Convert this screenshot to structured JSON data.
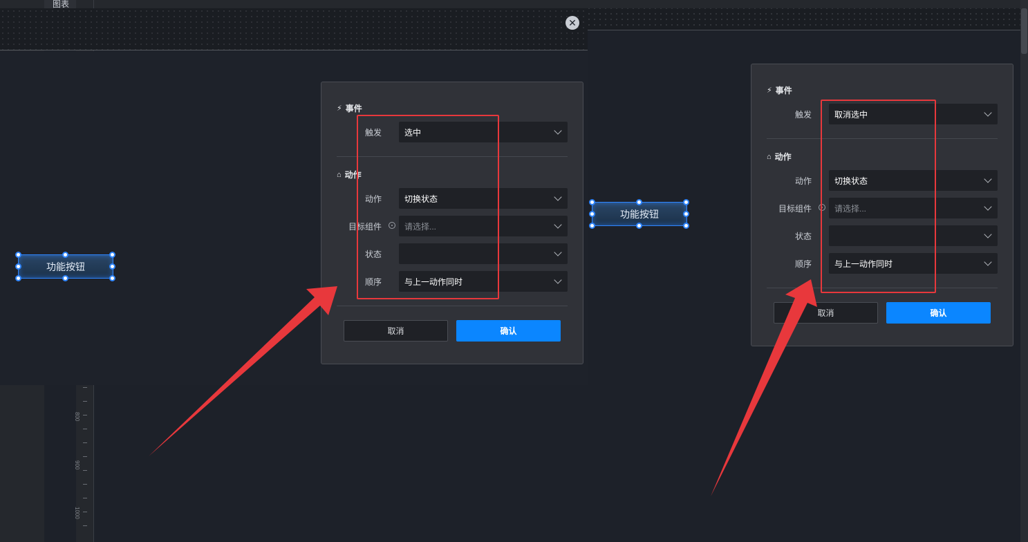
{
  "editor": {
    "tab_label": "图表",
    "ruler_numbers": [
      "800",
      "900",
      "1000"
    ]
  },
  "left_dialog": {
    "close_symbol": "✕",
    "component_label": "功能按钮",
    "panel": {
      "event_section": "事件",
      "trigger_label": "触发",
      "trigger_value": "选中",
      "action_section": "动作",
      "action_label": "动作",
      "action_value": "切换状态",
      "target_label": "目标组件",
      "target_placeholder": "请选择...",
      "state_label": "状态",
      "state_value": "",
      "order_label": "顺序",
      "order_value": "与上一动作同时",
      "cancel_label": "取消",
      "confirm_label": "确认"
    }
  },
  "right_view": {
    "component_label": "功能按钮",
    "panel": {
      "event_section": "事件",
      "trigger_label": "触发",
      "trigger_value": "取消选中",
      "action_section": "动作",
      "action_label": "动作",
      "action_value": "切换状态",
      "target_label": "目标组件",
      "target_placeholder": "请选择...",
      "state_label": "状态",
      "state_value": "",
      "order_label": "顺序",
      "order_value": "与上一动作同时",
      "cancel_label": "取消",
      "confirm_label": "确认"
    }
  },
  "icons": {
    "event": "lightning-icon",
    "action": "action-icon",
    "target": "target-icon",
    "dropdown": "chevron-down-icon",
    "close": "close-icon"
  },
  "colors": {
    "highlight": "#e8383c",
    "primary": "#0b86ff",
    "selection": "#2f86ff"
  }
}
